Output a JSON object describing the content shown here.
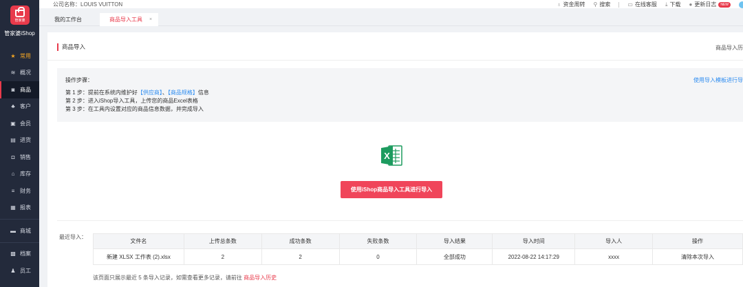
{
  "sidebar": {
    "logo_text": "管家婆",
    "brand": "管家婆iShop",
    "items": [
      {
        "label": "常用",
        "icon": "star-icon",
        "glyph": "★"
      },
      {
        "label": "概况",
        "icon": "layers-icon",
        "glyph": "≋"
      },
      {
        "label": "商品",
        "icon": "goods-icon",
        "glyph": "◙"
      },
      {
        "label": "客户",
        "icon": "customer-icon",
        "glyph": "♣"
      },
      {
        "label": "会员",
        "icon": "member-icon",
        "glyph": "▣"
      },
      {
        "label": "进货",
        "icon": "cart-icon",
        "glyph": "▤"
      },
      {
        "label": "销售",
        "icon": "sale-icon",
        "glyph": "◘"
      },
      {
        "label": "库存",
        "icon": "warehouse-icon",
        "glyph": "⌂"
      },
      {
        "label": "财务",
        "icon": "finance-icon",
        "glyph": "≡"
      },
      {
        "label": "报表",
        "icon": "report-icon",
        "glyph": "▦"
      },
      {
        "label": "商城",
        "icon": "mall-icon",
        "glyph": "▬"
      },
      {
        "label": "档案",
        "icon": "archive-icon",
        "glyph": "▩"
      },
      {
        "label": "员工",
        "icon": "staff-icon",
        "glyph": "♟"
      }
    ]
  },
  "topbar": {
    "company": "公司名称：LOUIS VUITTON",
    "capital": "资金周转",
    "search": "搜索",
    "service": "在线客服",
    "download": "下载",
    "changelog": "更新日志",
    "new_badge": "NEW"
  },
  "tabs": {
    "home": "我的工作台",
    "current": "商品导入工具",
    "close": "×"
  },
  "page": {
    "title": "商品导入",
    "history_link": "商品导入历",
    "steps_head": "操作步骤：",
    "template_link": "使用导入模板进行导",
    "step1_pre": "第 1 步：提前在系统内维护好",
    "step1_link1": "【供应商】",
    "step1_mid": "、",
    "step1_link2": "【商品规格】",
    "step1_post": "信息",
    "step2": "第 2 步：进入iShop导入工具，上传您的商品Excel表格",
    "step3": "第 3 步：在工具内设置对应的商品信息数据，并完成导入",
    "import_button": "使用iShop商品导入工具进行导入",
    "recent_label": "最近导入：",
    "foot_pre": "该页面只展示最近 5 条导入记录，如需查看更多记录，请前往",
    "foot_link": "商品导入历史"
  },
  "table": {
    "headers": [
      "文件名",
      "上传总条数",
      "成功条数",
      "失败条数",
      "导入结果",
      "导入时间",
      "导入人",
      "操作"
    ],
    "rows": [
      [
        "新建 XLSX 工作表 (2).xlsx",
        "2",
        "2",
        "0",
        "全部成功",
        "2022-08-22 14:17:29",
        "xxxx",
        "清除本次导入"
      ]
    ]
  },
  "colors": {
    "accent": "#e83a4b",
    "link": "#2d8cf0",
    "excel_green": "#1d9b5f",
    "sidebar_bg": "#232a3b"
  }
}
